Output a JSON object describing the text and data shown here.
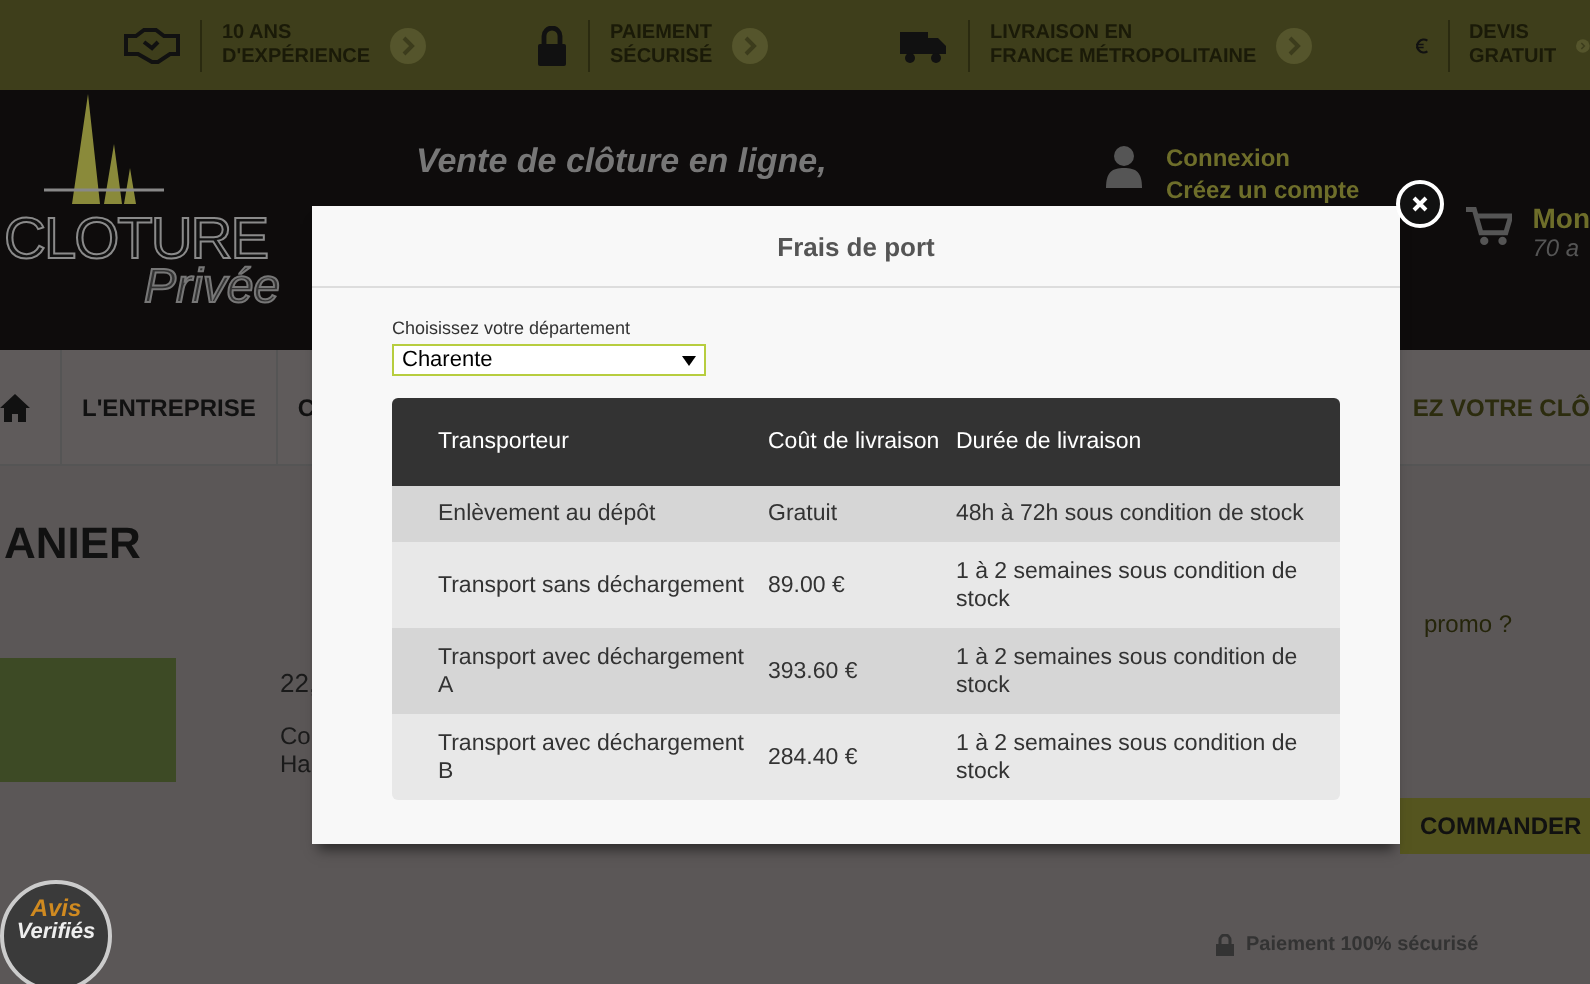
{
  "top_bar": {
    "items": [
      {
        "lines": [
          "10 ANS",
          "D'EXPÉRIENCE"
        ]
      },
      {
        "lines": [
          "PAIEMENT",
          "SÉCURISÉ"
        ]
      },
      {
        "lines": [
          "LIVRAISON EN",
          "FRANCE MÉTROPOLITAINE"
        ]
      },
      {
        "lines": [
          "DEVIS",
          "GRATUIT"
        ]
      }
    ]
  },
  "header": {
    "logo": {
      "line_1": "CLOTURE",
      "line_2": "Privée"
    },
    "tagline": "Vente de clôture en ligne,",
    "account": {
      "login": "Connexion",
      "register": "Créez un compte"
    },
    "cart": {
      "line_1": "Mon",
      "line_2": "70 a"
    }
  },
  "nav": {
    "items": [
      "L'ENTREPRISE",
      "C",
      "EZ VOTRE CLÔ"
    ]
  },
  "cart_page": {
    "title": "ANIER",
    "price": "22,",
    "details": [
      "Co",
      "Ha"
    ],
    "promo": "promo ?",
    "order_button": "COMMANDER",
    "secure_payment": "Paiement 100% sécurisé",
    "badge": {
      "line_1": "Avis",
      "line_2": "Verifiés"
    }
  },
  "modal": {
    "title": "Frais de port",
    "department_label": "Choisissez votre département",
    "department": "Charente",
    "table": {
      "columns": [
        "Transporteur",
        "Coût de livraison",
        "Durée de livraison"
      ],
      "rows": [
        [
          "Enlèvement au dépôt",
          "Gratuit",
          "48h à 72h sous condition de stock"
        ],
        [
          "Transport sans déchargement",
          "89.00 €",
          "1 à 2 semaines sous condition de stock"
        ],
        [
          "Transport avec déchargement A",
          "393.60 €",
          "1 à 2 semaines sous condition de stock"
        ],
        [
          "Transport avec déchargement B",
          "284.40 €",
          "1 à 2 semaines sous condition de stock"
        ]
      ]
    }
  }
}
